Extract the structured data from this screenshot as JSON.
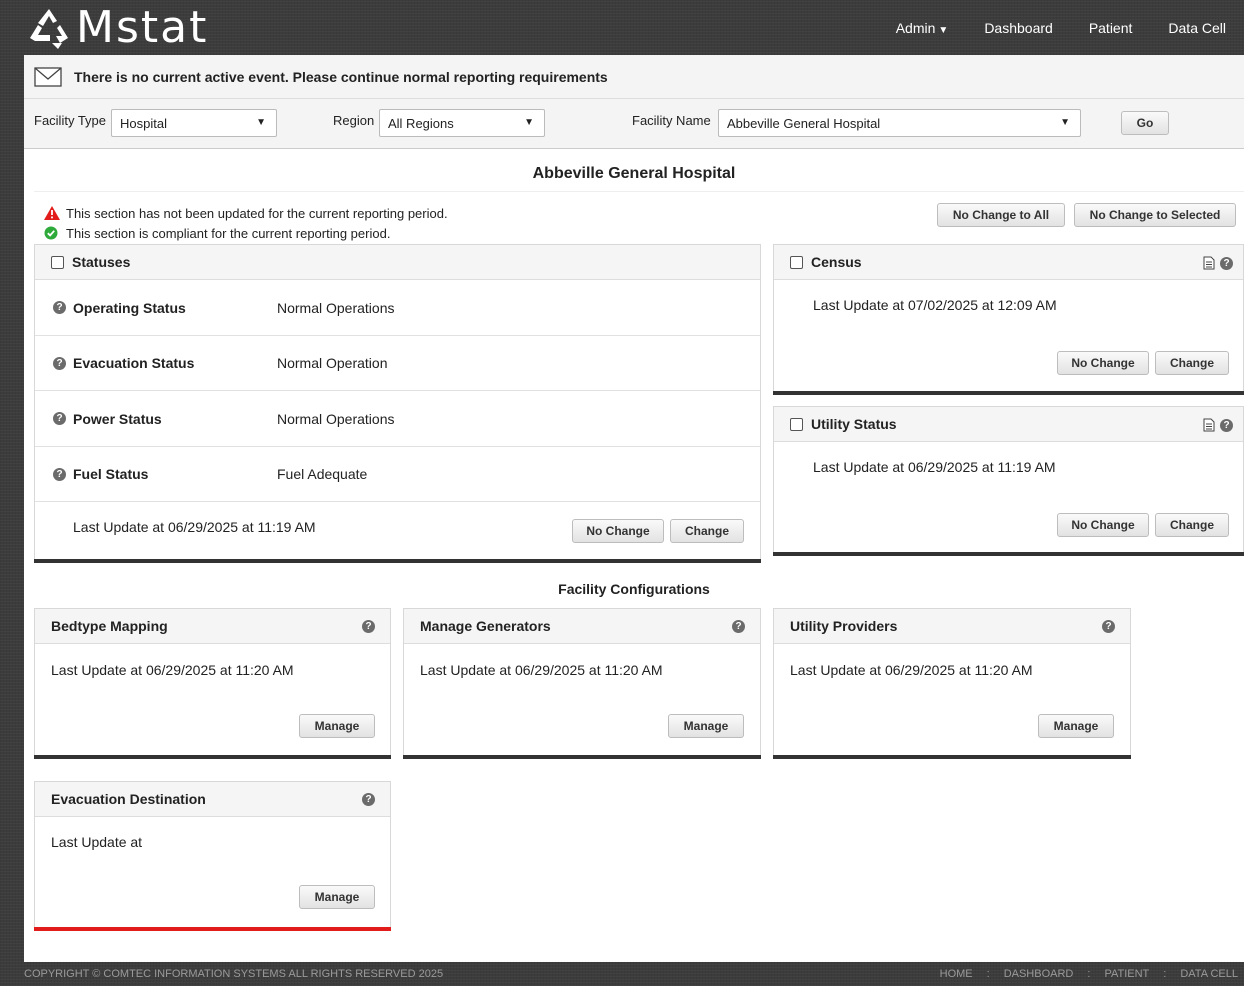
{
  "app": {
    "name": "Mstat"
  },
  "nav": {
    "admin": "Admin",
    "dashboard": "Dashboard",
    "patient": "Patient",
    "data_cell": "Data Cell"
  },
  "alert": {
    "text": "There is no current active event. Please continue normal reporting requirements"
  },
  "filters": {
    "facility_type_label": "Facility Type",
    "facility_type_value": "Hospital",
    "region_label": "Region",
    "region_value": "All Regions",
    "facility_name_label": "Facility Name",
    "facility_name_value": "Abbeville General Hospital",
    "go_label": "Go"
  },
  "facility_title": "Abbeville General Hospital",
  "legend": {
    "not_updated": "This section has not been updated for the current reporting period.",
    "compliant": "This section is compliant for the current reporting period."
  },
  "actions": {
    "no_change_all": "No Change to All",
    "no_change_selected": "No Change to Selected"
  },
  "statuses": {
    "title": "Statuses",
    "rows": [
      {
        "label": "Operating Status",
        "value": "Normal Operations"
      },
      {
        "label": "Evacuation Status",
        "value": "Normal Operation"
      },
      {
        "label": "Power Status",
        "value": "Normal Operations"
      },
      {
        "label": "Fuel Status",
        "value": "Fuel Adequate"
      }
    ],
    "last_update": "Last Update at 06/29/2025 at 11:19 AM",
    "no_change": "No Change",
    "change": "Change"
  },
  "census": {
    "title": "Census",
    "last_update": "Last Update at 07/02/2025 at 12:09 AM",
    "no_change": "No Change",
    "change": "Change"
  },
  "utility_status": {
    "title": "Utility Status",
    "last_update": "Last Update at 06/29/2025 at 11:19 AM",
    "no_change": "No Change",
    "change": "Change"
  },
  "facility_configurations": {
    "title": "Facility Configurations",
    "cards": [
      {
        "title": "Bedtype Mapping",
        "last_update": "Last Update at 06/29/2025 at 11:20 AM",
        "button": "Manage"
      },
      {
        "title": "Manage Generators",
        "last_update": "Last Update at 06/29/2025 at 11:20 AM",
        "button": "Manage"
      },
      {
        "title": "Utility Providers",
        "last_update": "Last Update at 06/29/2025 at 11:20 AM",
        "button": "Manage"
      },
      {
        "title": "Evacuation Destination",
        "last_update": "Last Update at",
        "button": "Manage"
      }
    ]
  },
  "footer": {
    "copyright": "COPYRIGHT © COMTEC INFORMATION SYSTEMS ALL RIGHTS RESERVED 2025",
    "links": [
      "HOME",
      "DASHBOARD",
      "PATIENT",
      "DATA CELL"
    ],
    "separator": ":"
  },
  "colors": {
    "warning": "#e21b1b",
    "success": "#2eaa3a",
    "accent_bottom": "#333333"
  }
}
